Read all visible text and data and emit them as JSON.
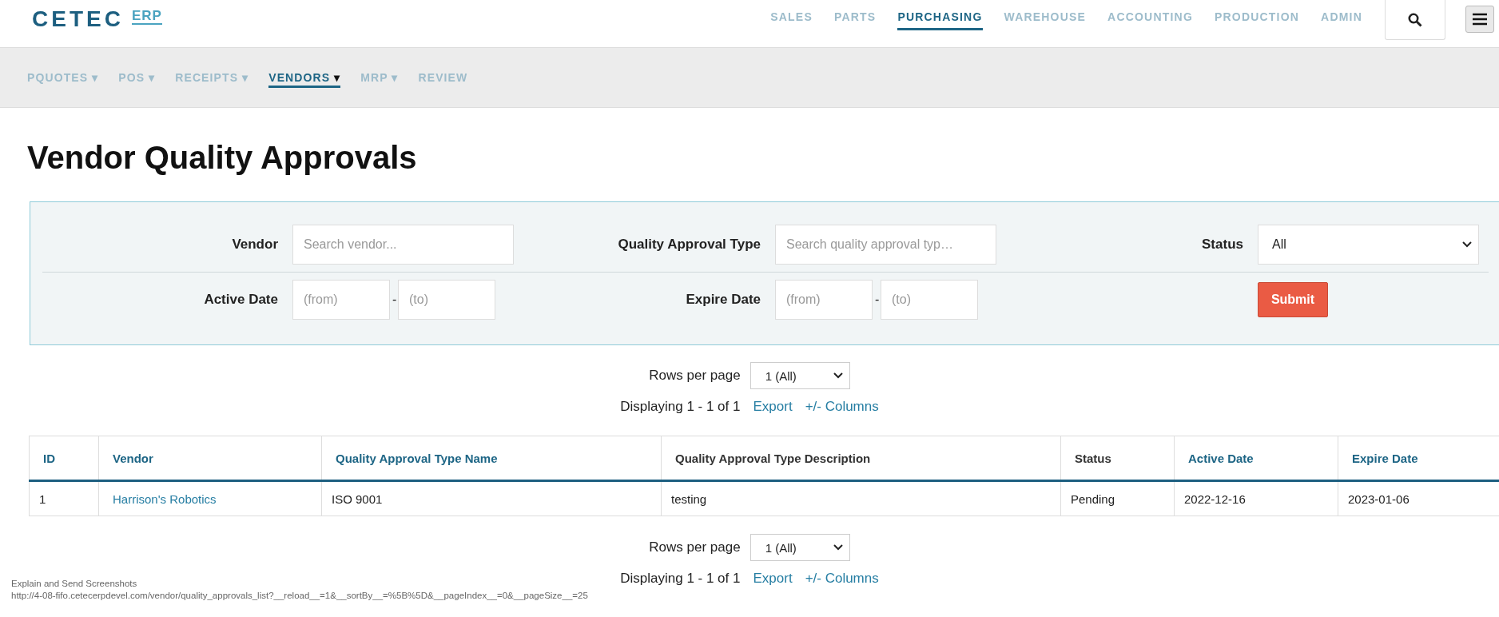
{
  "header": {
    "logo": "CETEC",
    "logo_suffix": "ERP",
    "nav": [
      {
        "label": "SALES",
        "selected": false
      },
      {
        "label": "PARTS",
        "selected": false
      },
      {
        "label": "PURCHASING",
        "selected": true
      },
      {
        "label": "WAREHOUSE",
        "selected": false
      },
      {
        "label": "ACCOUNTING",
        "selected": false
      },
      {
        "label": "PRODUCTION",
        "selected": false
      },
      {
        "label": "ADMIN",
        "selected": false
      }
    ]
  },
  "subnav": [
    {
      "label": "PQUOTES",
      "caret": "▾",
      "selected": false
    },
    {
      "label": "POS",
      "caret": "▾",
      "selected": false
    },
    {
      "label": "RECEIPTS",
      "caret": "▾",
      "selected": false
    },
    {
      "label": "VENDORS",
      "caret": "▾",
      "selected": true
    },
    {
      "label": "MRP",
      "caret": "▾",
      "selected": false
    },
    {
      "label": "REVIEW",
      "selected": false
    }
  ],
  "title": "Vendor Quality Approvals",
  "filters": {
    "vendor": {
      "label": "Vendor",
      "placeholder": "Search vendor..."
    },
    "approval_type": {
      "label": "Quality Approval Type",
      "placeholder": "Search quality approval typ…"
    },
    "status": {
      "label": "Status",
      "value": "All"
    },
    "active_date": {
      "label": "Active Date",
      "from_placeholder": "(from)",
      "separator": "-",
      "to_placeholder": "(to)"
    },
    "expire_date": {
      "label": "Expire Date",
      "from_placeholder": "(from)",
      "separator": "-",
      "to_placeholder": "(to)"
    },
    "submit": "Submit"
  },
  "pagination_top": {
    "rows_label": "Rows per page",
    "rows_value": "1 (All)",
    "displaying": "Displaying 1 - 1 of 1",
    "links": [
      "Export",
      "+/- Columns"
    ]
  },
  "table": {
    "columns": [
      {
        "label": "ID",
        "sortable": true
      },
      {
        "label": "Vendor",
        "sortable": true
      },
      {
        "label": "Quality Approval Type Name",
        "sortable": true
      },
      {
        "label": "Quality Approval Type Description",
        "sortable": false
      },
      {
        "label": "Status",
        "sortable": false
      },
      {
        "label": "Active Date",
        "sortable": true
      },
      {
        "label": "Expire Date",
        "sortable": true
      }
    ],
    "rows": [
      {
        "cells": [
          {
            "text": "1",
            "link": false
          },
          {
            "text": "Harrison's Robotics",
            "link": true
          },
          {
            "text": "ISO 9001",
            "link": false
          },
          {
            "text": "testing",
            "link": false
          },
          {
            "text": "Pending",
            "link": false
          },
          {
            "text": "2022-12-16",
            "link": false
          },
          {
            "text": "2023-01-06",
            "link": false
          }
        ]
      }
    ]
  },
  "pagination_bottom": {
    "rows_label": "Rows per page",
    "rows_value": "1 (All)",
    "displaying": "Displaying 1 - 1 of 1",
    "links": [
      "Export",
      "+/- Columns"
    ]
  },
  "overlay": {
    "title": "Explain and Send Screenshots",
    "url": "http://4-08-fifo.cetecerpdevel.com/vendor/quality_approvals_list?__reload__=1&__sortBy__=%5B%5D&__pageIndex__=0&__pageSize__=25"
  }
}
